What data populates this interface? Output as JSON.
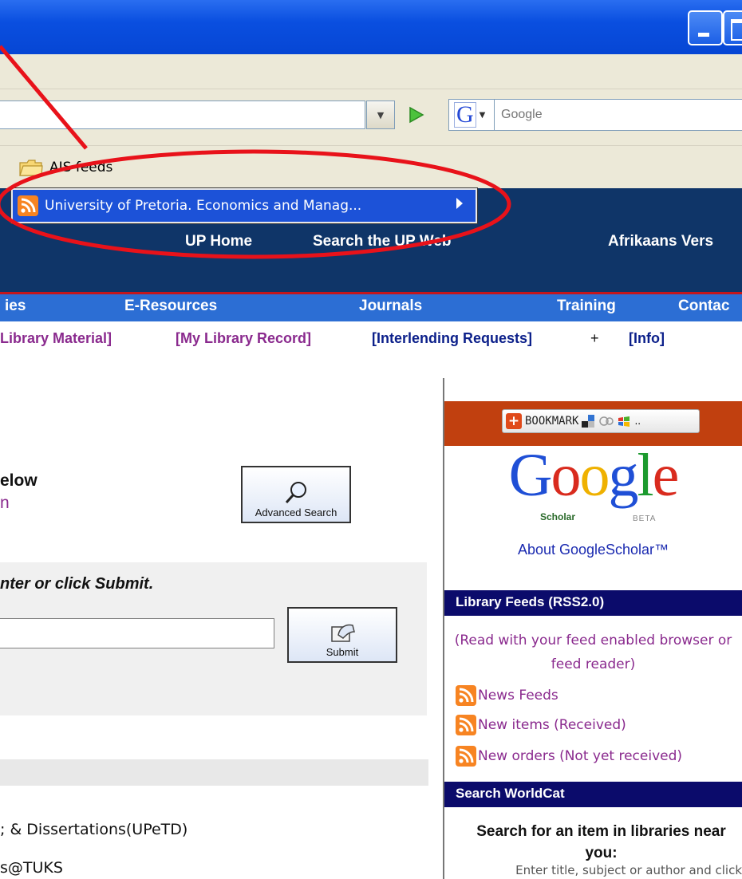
{
  "browser": {
    "address_value": "",
    "search_placeholder": "Google",
    "search_engine_letter": "G",
    "bookmark_folder": "AIS feeds",
    "popup_item": "University of Pretoria. Economics and Manag..."
  },
  "banner": {
    "links": [
      "UP Home",
      "Search the UP Web",
      "Afrikaans Vers"
    ]
  },
  "navigation": {
    "items": [
      "ies",
      "E-Resources",
      "Journals",
      "Training",
      "Contac"
    ]
  },
  "sub_navigation": {
    "items": [
      "Library Material]",
      "[My Library Record]",
      "[Interlending Requests]",
      "+",
      "[Info]"
    ]
  },
  "main": {
    "below_text": "elow",
    "below_link": "n",
    "advanced_search_label": "Advanced Search",
    "instruction": "nter or click Submit.",
    "query_value": "",
    "submit_label": "Submit",
    "etd_link": "; & Dissertations(UPeTD)",
    "tuks_link": "s@TUKS"
  },
  "sidebar": {
    "bookmark_label": "BOOKMARK",
    "google_letters": [
      "G",
      "o",
      "o",
      "g",
      "l",
      "e"
    ],
    "scholar_label": "Scholar",
    "beta_label": "BETA",
    "about_scholar": "About GoogleScholar™",
    "feeds_header": "Library Feeds (RSS2.0)",
    "feeds_note": "(Read with your feed enabled browser or feed reader)",
    "feeds": [
      "News Feeds",
      "New items (Received)",
      "New orders (Not yet received)"
    ],
    "worldcat_header": "Search WorldCat",
    "worldcat_heading": "Search for an item in libraries near you:",
    "worldcat_hint": "Enter title, subject or author and click"
  },
  "colors": {
    "banner": "#0f3568",
    "nav_blue": "#2c6ed4",
    "link_purple": "#8a2a8e",
    "annotation_red": "#e8121a"
  },
  "icons": [
    "folder-icon",
    "rss-icon",
    "search-magnifier-icon",
    "submit-hand-icon",
    "go-arrow-icon",
    "bookmark-plus-icon"
  ]
}
